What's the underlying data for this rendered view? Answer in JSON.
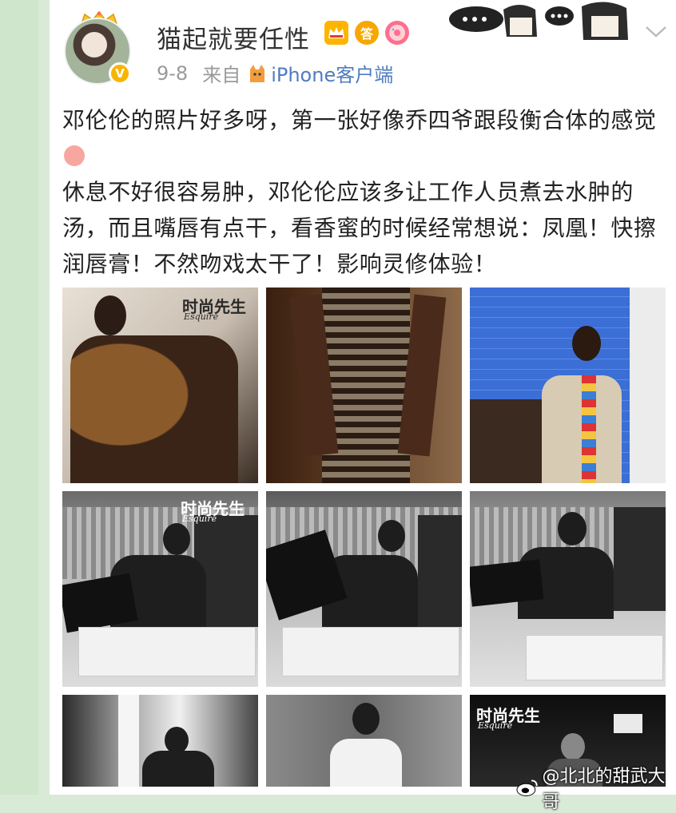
{
  "post": {
    "username": "猫起就要任性",
    "date": "9-8",
    "from_label": "来自",
    "client": "iPhone客户端",
    "verified_mark": "V",
    "badge_labels": [
      "答"
    ],
    "paragraphs": [
      "邓伦伦的照片好多呀，第一张好像乔四爷跟段衡合体的感觉",
      "休息不好很容易肿，邓伦伦应该多让工作人员煮去水肿的汤，而且嘴唇有点干，看香蜜的时候经常想说：凤凰！快擦润唇膏！不然吻戏太干了！影响灵修体验！"
    ]
  },
  "photos": {
    "mag_title": "时尚先生",
    "mag_sub": "Esquire"
  },
  "watermark": {
    "text": "@北北的甜武大哥"
  },
  "colors": {
    "accent_link": "#4f7cbf",
    "background_green": "#d9ead7",
    "verified": "#f7b500"
  },
  "icons": [
    "crown-icon",
    "verified-icon",
    "vip-crown-icon",
    "answer-badge-icon",
    "donut-icon",
    "cat-icon",
    "sticker-icon",
    "chevron-down-icon",
    "weibo-icon"
  ]
}
